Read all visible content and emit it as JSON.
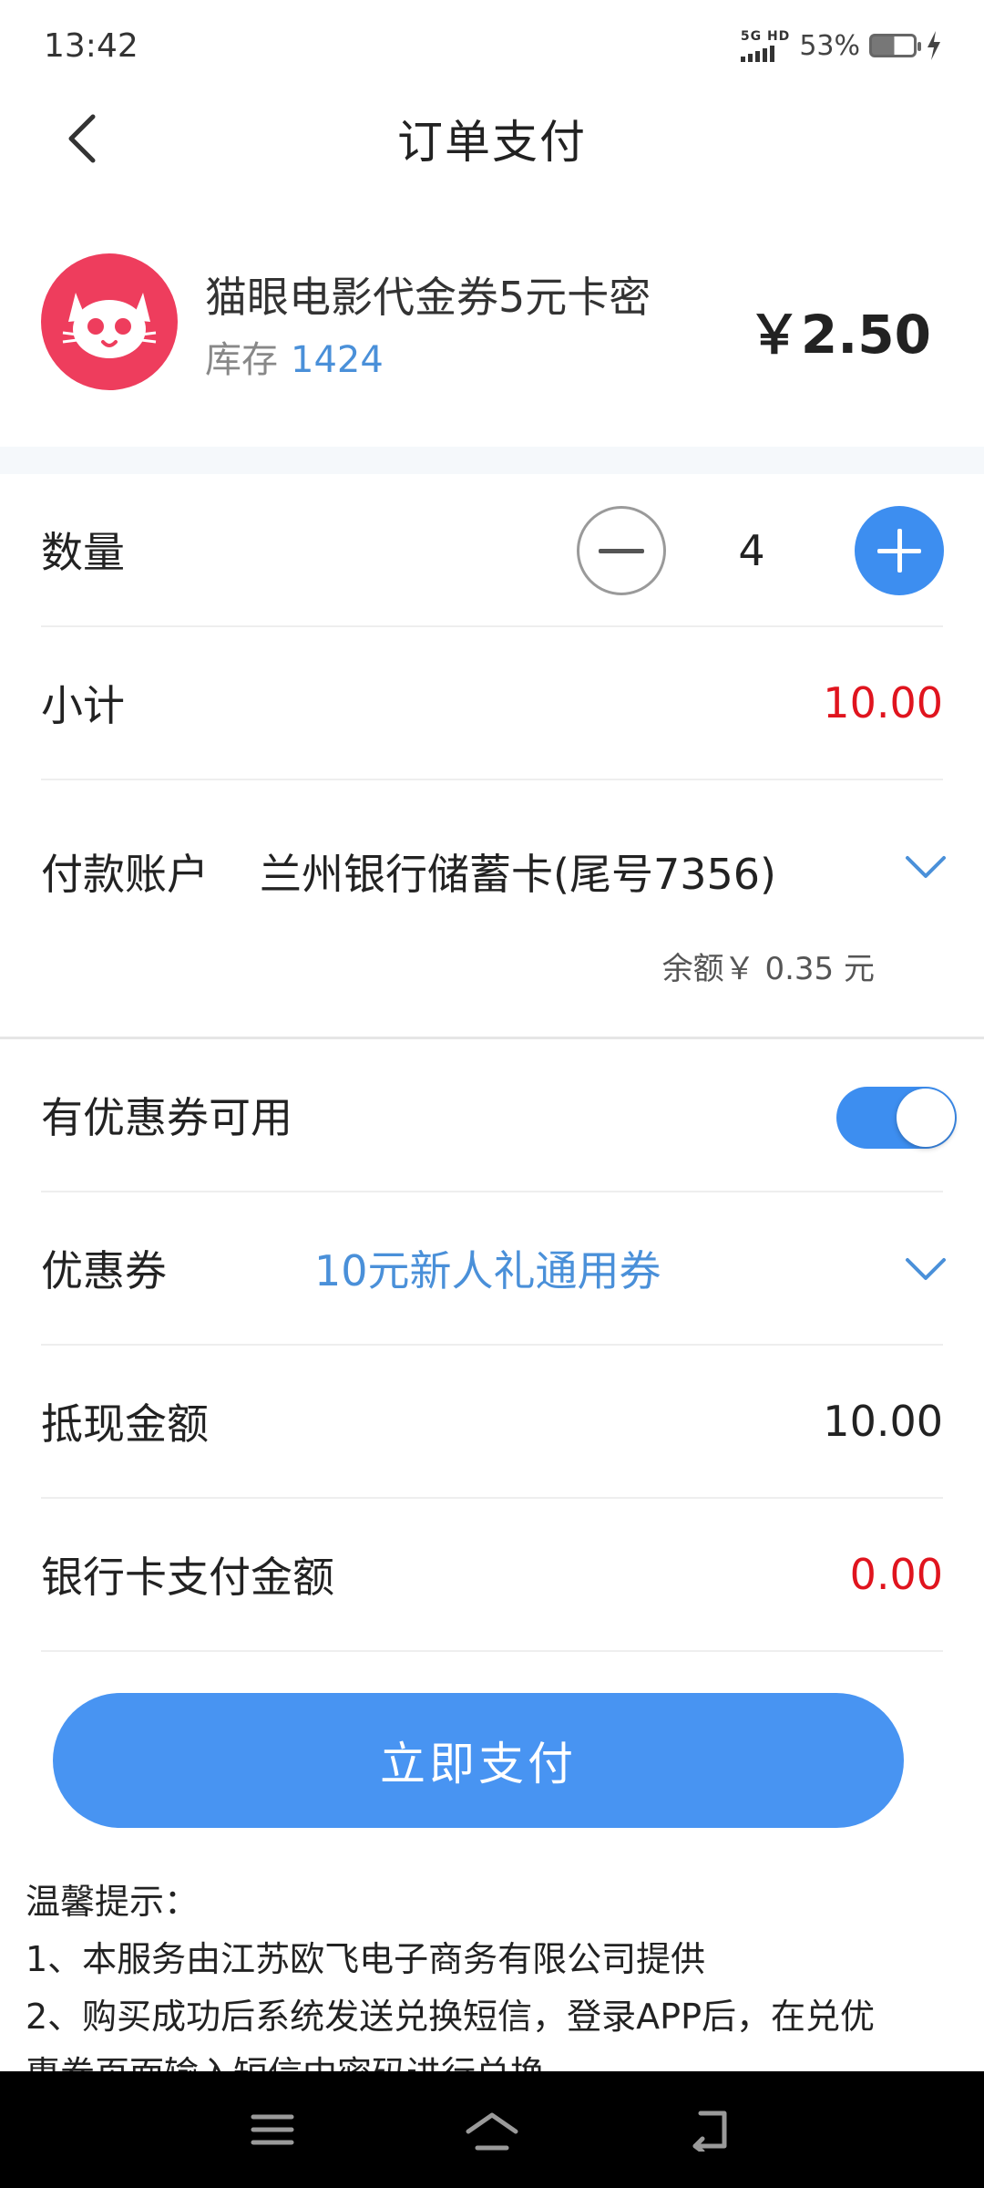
{
  "status_bar": {
    "time": "13:42",
    "network": "5G HD",
    "battery": "53%",
    "battery_level": 0.53
  },
  "header": {
    "title": "订单支付",
    "back_icon": "chevron-left-icon"
  },
  "product": {
    "name": "猫眼电影代金券5元卡密",
    "stock_label": "库存",
    "stock_value": "1424",
    "price": "￥2.50",
    "logo_icon": "cat-face-icon",
    "logo_color": "#ee3d5d"
  },
  "quantity": {
    "label": "数量",
    "value": "4"
  },
  "subtotal": {
    "label": "小计",
    "value": "10.00"
  },
  "account": {
    "label": "付款账户",
    "value": "兰州银行储蓄卡(尾号7356)",
    "balance": "余额￥ 0.35 元"
  },
  "coupon_available": {
    "label": "有优惠券可用",
    "enabled": true
  },
  "coupon": {
    "label": "优惠券",
    "value": "10元新人礼通用券"
  },
  "deduction": {
    "label": "抵现金额",
    "value": "10.00"
  },
  "card_payment": {
    "label": "银行卡支付金额",
    "value": "0.00"
  },
  "pay_button": {
    "label": "立即支付"
  },
  "tips": {
    "title": "温馨提示：",
    "line1": "1、本服务由江苏欧飞电子商务有限公司提供",
    "line2": "2、购买成功后系统发送兑换短信，登录APP后，在兑优",
    "line3": "惠券页面输入短信中密码进行兑换"
  },
  "colors": {
    "accent": "#3d8ef0",
    "button": "#4894f2",
    "price_red": "#e0141e",
    "link_blue": "#4a90d9"
  }
}
